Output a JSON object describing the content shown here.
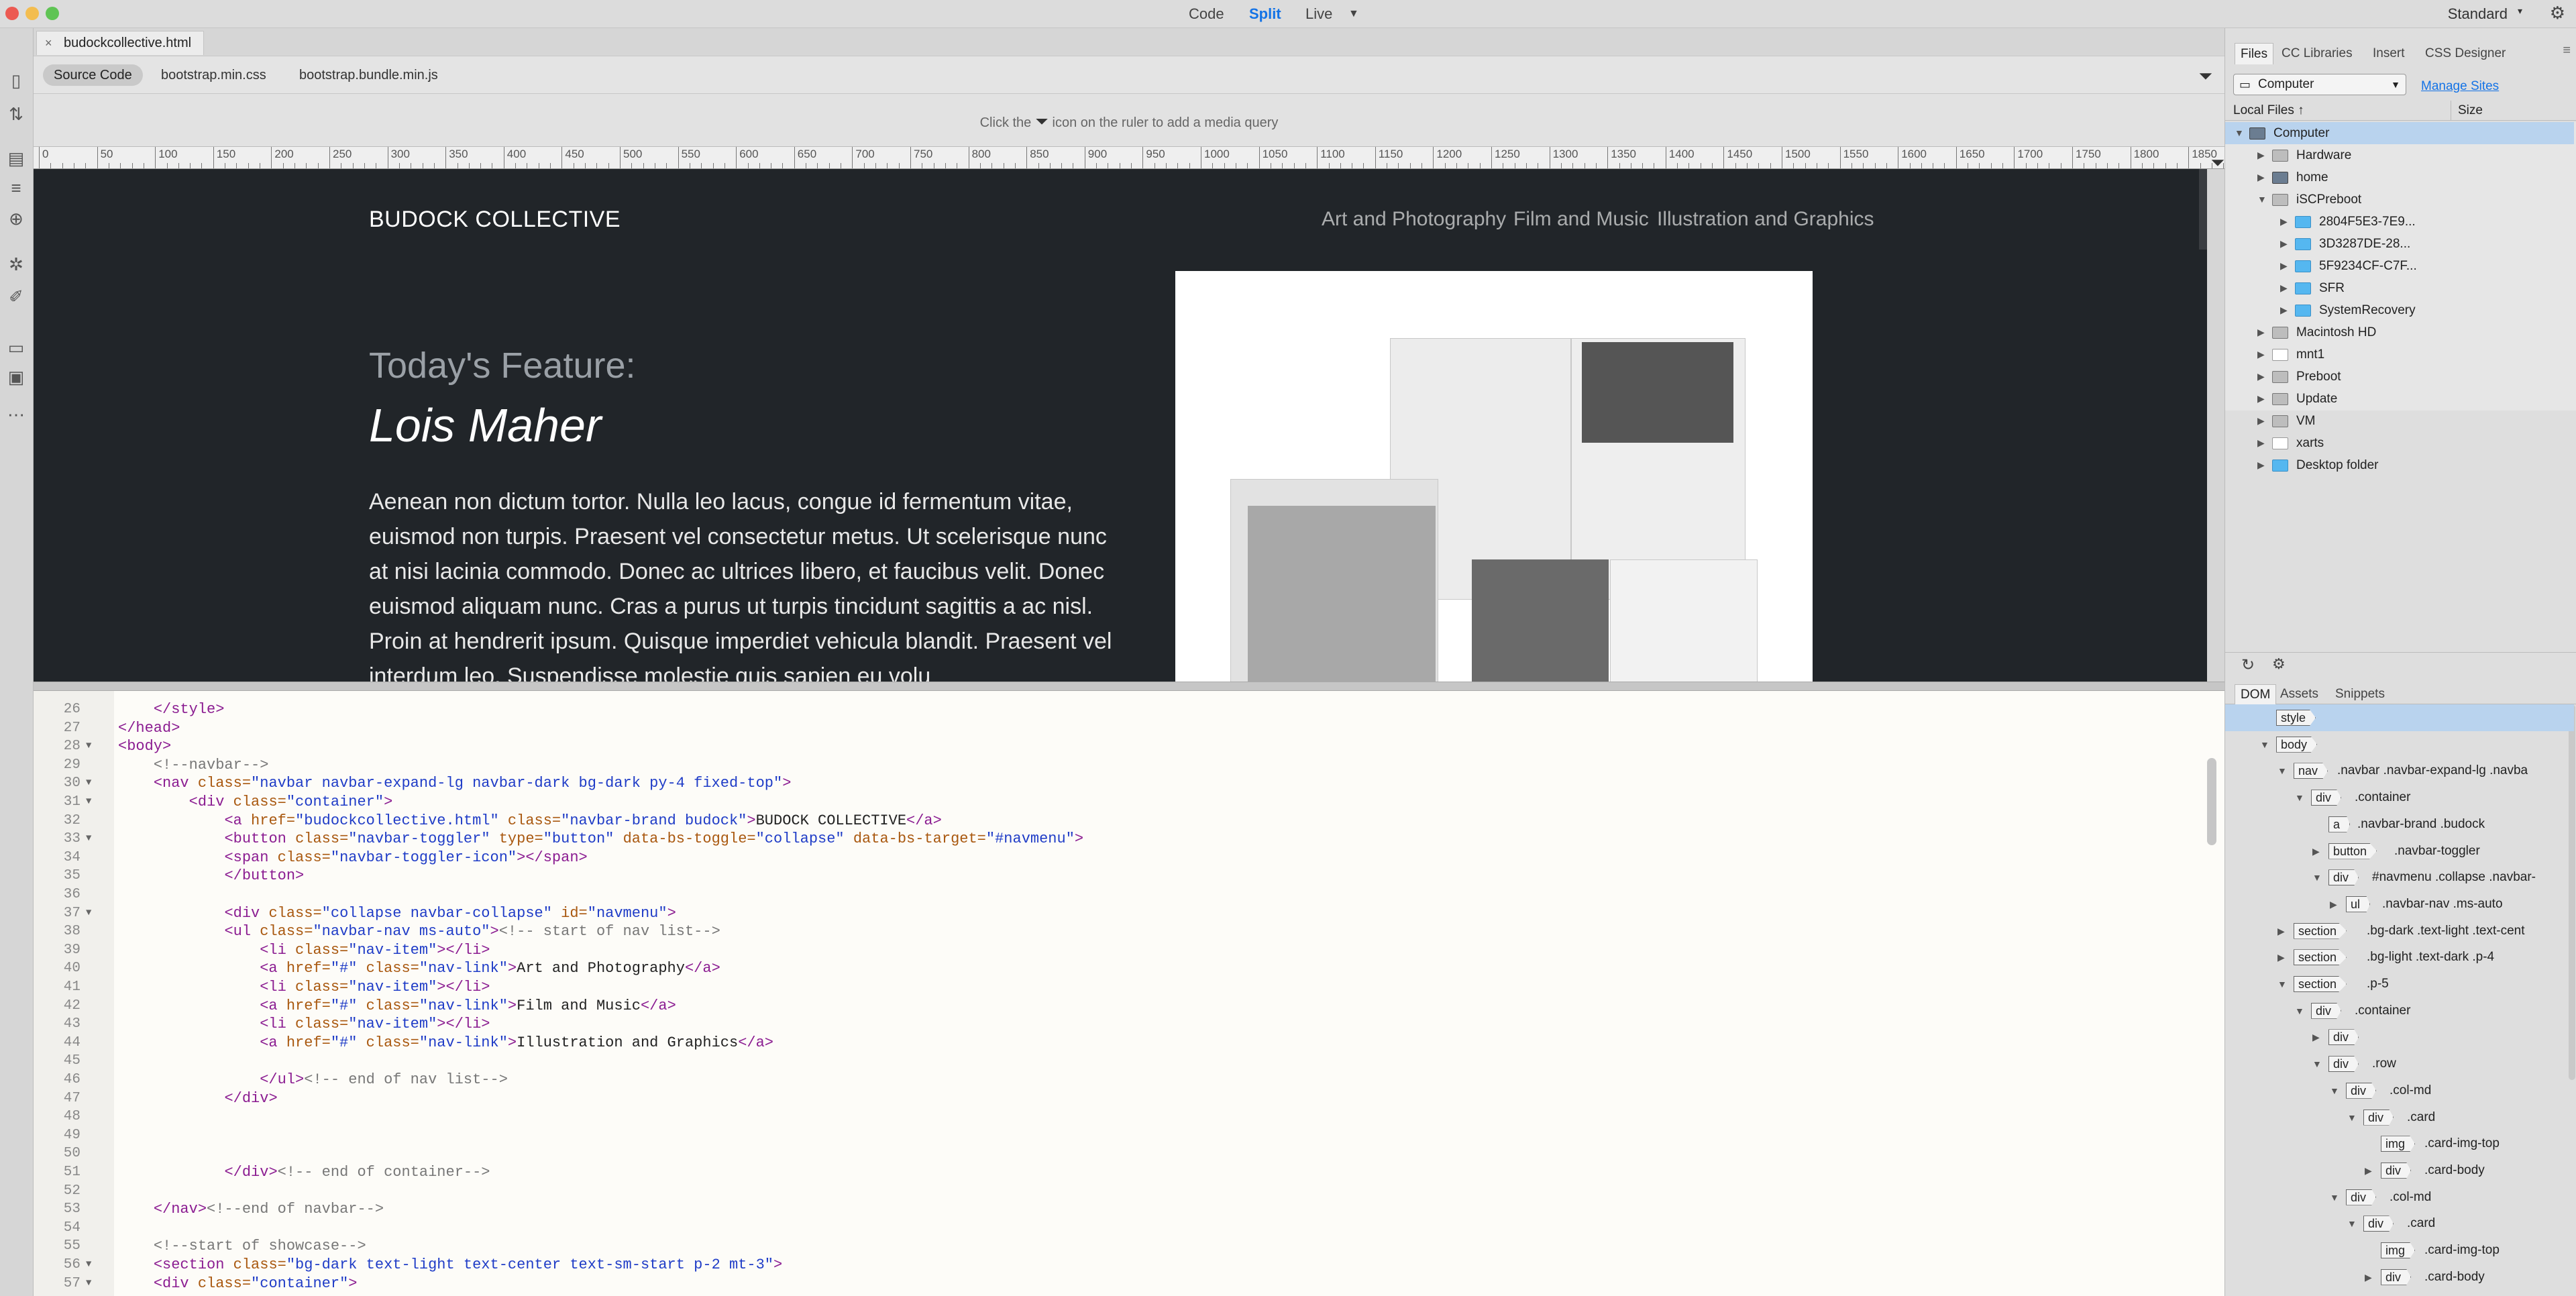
{
  "window": {
    "view_buttons": [
      "Code",
      "Split",
      "Live"
    ],
    "workspace": "Standard"
  },
  "doc_tab": {
    "name": "budockcollective.html"
  },
  "related_files": [
    "Source Code",
    "bootstrap.min.css",
    "bootstrap.bundle.min.js"
  ],
  "media_query": {
    "before": "Click the",
    "after": "icon on the ruler to add a media query"
  },
  "ruler": [
    "0",
    "50",
    "100",
    "150",
    "200",
    "250",
    "300",
    "350",
    "400",
    "450",
    "500",
    "550",
    "600",
    "650",
    "700",
    "750",
    "800",
    "850",
    "900",
    "950",
    "1000",
    "1050",
    "1100",
    "1150",
    "1200",
    "1250",
    "1300",
    "1350",
    "1400",
    "1450",
    "1500",
    "1550",
    "1600",
    "1650",
    "1700",
    "1750",
    "1800",
    "1850"
  ],
  "preview": {
    "brand": "BUDOCK COLLECTIVE",
    "nav": [
      "Art and Photography",
      "Film and Music",
      "Illustration and Graphics"
    ],
    "heading": "Today's Feature:",
    "name": "Lois Maher",
    "body": "Aenean non dictum tortor. Nulla leo lacus, congue id fermentum vitae, euismod non turpis. Praesent vel consectetur metus. Ut scelerisque nunc at nisi lacinia commodo. Donec ac ultrices libero, et faucibus velit. Donec euismod aliquam nunc. Cras a purus ut turpis tincidunt sagittis a ac nisl. Proin at hendrerit ipsum. Quisque imperdiet vehicula blandit. Praesent vel interdum leo. Suspendisse molestie quis sapien eu volu"
  },
  "code": {
    "lines": [
      {
        "n": "26",
        "fold": "",
        "html": "    <span class=\"tg\">&lt;/style&gt;</span>"
      },
      {
        "n": "27",
        "fold": "",
        "html": "<span class=\"tg\">&lt;/head&gt;</span>"
      },
      {
        "n": "28",
        "fold": "▼",
        "html": "<span class=\"tg\">&lt;body&gt;</span>"
      },
      {
        "n": "29",
        "fold": "",
        "html": "    <span class=\"cm\">&lt;!--navbar--&gt;</span>"
      },
      {
        "n": "30",
        "fold": "▼",
        "html": "    <span class=\"tg\">&lt;nav</span> <span class=\"at\">class=</span><span class=\"vl\">\"navbar navbar-expand-lg navbar-dark bg-dark py-4 fixed-top\"</span><span class=\"tg\">&gt;</span>"
      },
      {
        "n": "31",
        "fold": "▼",
        "html": "        <span class=\"tg\">&lt;div</span> <span class=\"at\">class=</span><span class=\"vl\">\"container\"</span><span class=\"tg\">&gt;</span>"
      },
      {
        "n": "32",
        "fold": "",
        "html": "            <span class=\"tg\">&lt;a</span> <span class=\"at\">href=</span><span class=\"vl\">\"budockcollective.html\"</span> <span class=\"at\">class=</span><span class=\"vl\">\"navbar-brand budock\"</span><span class=\"tg\">&gt;</span><span class=\"tx\">BUDOCK COLLECTIVE</span><span class=\"tg\">&lt;/a&gt;</span>"
      },
      {
        "n": "33",
        "fold": "▼",
        "html": "            <span class=\"tg\">&lt;button</span> <span class=\"at\">class=</span><span class=\"vl\">\"navbar-toggler\"</span> <span class=\"at\">type=</span><span class=\"vl\">\"button\"</span> <span class=\"at\">data-bs-toggle=</span><span class=\"vl\">\"collapse\"</span> <span class=\"at\">data-bs-target=</span><span class=\"vl\">\"#navmenu\"</span><span class=\"tg\">&gt;</span>"
      },
      {
        "n": "34",
        "fold": "",
        "html": "            <span class=\"tg\">&lt;span</span> <span class=\"at\">class=</span><span class=\"vl\">\"navbar-toggler-icon\"</span><span class=\"tg\">&gt;&lt;/span&gt;</span>"
      },
      {
        "n": "35",
        "fold": "",
        "html": "            <span class=\"tg\">&lt;/button&gt;</span>"
      },
      {
        "n": "36",
        "fold": "",
        "html": ""
      },
      {
        "n": "37",
        "fold": "▼",
        "html": "            <span class=\"tg\">&lt;div</span> <span class=\"at\">class=</span><span class=\"vl\">\"collapse navbar-collapse\"</span> <span class=\"at\">id=</span><span class=\"vl\">\"navmenu\"</span><span class=\"tg\">&gt;</span>"
      },
      {
        "n": "38",
        "fold": "",
        "html": "            <span class=\"tg\">&lt;ul</span> <span class=\"at\">class=</span><span class=\"vl\">\"navbar-nav ms-auto\"</span><span class=\"tg\">&gt;</span><span class=\"cm\">&lt;!-- start of nav list--&gt;</span>"
      },
      {
        "n": "39",
        "fold": "",
        "html": "                <span class=\"tg\">&lt;li</span> <span class=\"at\">class=</span><span class=\"vl\">\"nav-item\"</span><span class=\"tg\">&gt;&lt;/li&gt;</span>"
      },
      {
        "n": "40",
        "fold": "",
        "html": "                <span class=\"tg\">&lt;a</span> <span class=\"at\">href=</span><span class=\"vl\">\"#\"</span> <span class=\"at\">class=</span><span class=\"vl\">\"nav-link\"</span><span class=\"tg\">&gt;</span><span class=\"tx\">Art and Photography</span><span class=\"tg\">&lt;/a&gt;</span>"
      },
      {
        "n": "41",
        "fold": "",
        "html": "                <span class=\"tg\">&lt;li</span> <span class=\"at\">class=</span><span class=\"vl\">\"nav-item\"</span><span class=\"tg\">&gt;&lt;/li&gt;</span>"
      },
      {
        "n": "42",
        "fold": "",
        "html": "                <span class=\"tg\">&lt;a</span> <span class=\"at\">href=</span><span class=\"vl\">\"#\"</span> <span class=\"at\">class=</span><span class=\"vl\">\"nav-link\"</span><span class=\"tg\">&gt;</span><span class=\"tx\">Film and Music</span><span class=\"tg\">&lt;/a&gt;</span>"
      },
      {
        "n": "43",
        "fold": "",
        "html": "                <span class=\"tg\">&lt;li</span> <span class=\"at\">class=</span><span class=\"vl\">\"nav-item\"</span><span class=\"tg\">&gt;&lt;/li&gt;</span>"
      },
      {
        "n": "44",
        "fold": "",
        "html": "                <span class=\"tg\">&lt;a</span> <span class=\"at\">href=</span><span class=\"vl\">\"#\"</span> <span class=\"at\">class=</span><span class=\"vl\">\"nav-link\"</span><span class=\"tg\">&gt;</span><span class=\"tx\">Illustration and Graphics</span><span class=\"tg\">&lt;/a&gt;</span>"
      },
      {
        "n": "45",
        "fold": "",
        "html": ""
      },
      {
        "n": "46",
        "fold": "",
        "html": "                <span class=\"tg\">&lt;/ul&gt;</span><span class=\"cm\">&lt;!-- end of nav list--&gt;</span>"
      },
      {
        "n": "47",
        "fold": "",
        "html": "            <span class=\"tg\">&lt;/div&gt;</span>"
      },
      {
        "n": "48",
        "fold": "",
        "html": ""
      },
      {
        "n": "49",
        "fold": "",
        "html": ""
      },
      {
        "n": "50",
        "fold": "",
        "html": ""
      },
      {
        "n": "51",
        "fold": "",
        "html": "            <span class=\"tg\">&lt;/div&gt;</span><span class=\"cm\">&lt;!-- end of container--&gt;</span>"
      },
      {
        "n": "52",
        "fold": "",
        "html": ""
      },
      {
        "n": "53",
        "fold": "",
        "html": "    <span class=\"tg\">&lt;/nav&gt;</span><span class=\"cm\">&lt;!--end of navbar--&gt;</span>"
      },
      {
        "n": "54",
        "fold": "",
        "html": ""
      },
      {
        "n": "55",
        "fold": "",
        "html": "    <span class=\"cm\">&lt;!--start of showcase--&gt;</span>"
      },
      {
        "n": "56",
        "fold": "▼",
        "html": "    <span class=\"tg\">&lt;section</span> <span class=\"at\">class=</span><span class=\"vl\">\"bg-dark text-light text-center text-sm-start p-2 mt-3\"</span><span class=\"tg\">&gt;</span>"
      },
      {
        "n": "57",
        "fold": "▼",
        "html": "    <span class=\"tg\">&lt;div</span> <span class=\"at\">class=</span><span class=\"vl\">\"container\"</span><span class=\"tg\">&gt;</span>"
      }
    ]
  },
  "panel": {
    "tabs": [
      "Files",
      "CC Libraries",
      "Insert",
      "CSS Designer"
    ],
    "site": "Computer",
    "manage_sites": "Manage Sites",
    "local_files": "Local Files ↑",
    "size": "Size",
    "tree": [
      {
        "label": "Computer",
        "depth": 0,
        "arrow": "▼",
        "icon": "comp"
      },
      {
        "label": "Hardware",
        "depth": 1,
        "arrow": "▶",
        "icon": "drive"
      },
      {
        "label": "home",
        "depth": 1,
        "arrow": "▶",
        "icon": "comp"
      },
      {
        "label": "iSCPreboot",
        "depth": 1,
        "arrow": "▼",
        "icon": "drive"
      },
      {
        "label": "2804F5E3-7E9...",
        "depth": 2,
        "arrow": "▶",
        "icon": "folder"
      },
      {
        "label": "3D3287DE-28...",
        "depth": 2,
        "arrow": "▶",
        "icon": "folder"
      },
      {
        "label": "5F9234CF-C7F...",
        "depth": 2,
        "arrow": "▶",
        "icon": "folder"
      },
      {
        "label": "SFR",
        "depth": 2,
        "arrow": "▶",
        "icon": "folder"
      },
      {
        "label": "SystemRecovery",
        "depth": 2,
        "arrow": "▶",
        "icon": "folder"
      },
      {
        "label": "Macintosh HD",
        "depth": 1,
        "arrow": "▶",
        "icon": "drive"
      },
      {
        "label": "mnt1",
        "depth": 1,
        "arrow": "▶",
        "icon": "doc"
      },
      {
        "label": "Preboot",
        "depth": 1,
        "arrow": "▶",
        "icon": "drive"
      },
      {
        "label": "Update",
        "depth": 1,
        "arrow": "▶",
        "icon": "drive"
      },
      {
        "label": "VM",
        "depth": 1,
        "arrow": "▶",
        "icon": "drive"
      },
      {
        "label": "xarts",
        "depth": 1,
        "arrow": "▶",
        "icon": "doc"
      },
      {
        "label": "Desktop folder",
        "depth": 1,
        "arrow": "▶",
        "icon": "folder"
      }
    ],
    "dom_tabs": [
      "DOM",
      "Assets",
      "Snippets"
    ],
    "dom": [
      {
        "tag": "style",
        "sel": "",
        "depth": 0,
        "arrow": ""
      },
      {
        "tag": "body",
        "sel": "",
        "depth": 0,
        "arrow": "▼"
      },
      {
        "tag": "nav",
        "sel": ".navbar .navbar-expand-lg .navba",
        "depth": 1,
        "arrow": "▼"
      },
      {
        "tag": "div",
        "sel": ".container",
        "depth": 2,
        "arrow": "▼"
      },
      {
        "tag": "a",
        "sel": ".navbar-brand .budock",
        "depth": 3,
        "arrow": ""
      },
      {
        "tag": "button",
        "sel": ".navbar-toggler",
        "depth": 3,
        "arrow": "▶"
      },
      {
        "tag": "div",
        "sel": "#navmenu .collapse .navbar-",
        "depth": 3,
        "arrow": "▼"
      },
      {
        "tag": "ul",
        "sel": ".navbar-nav .ms-auto",
        "depth": 4,
        "arrow": "▶"
      },
      {
        "tag": "section",
        "sel": ".bg-dark .text-light .text-cent",
        "depth": 1,
        "arrow": "▶"
      },
      {
        "tag": "section",
        "sel": ".bg-light .text-dark .p-4",
        "depth": 1,
        "arrow": "▶"
      },
      {
        "tag": "section",
        "sel": ".p-5",
        "depth": 1,
        "arrow": "▼"
      },
      {
        "tag": "div",
        "sel": ".container",
        "depth": 2,
        "arrow": "▼"
      },
      {
        "tag": "div",
        "sel": "",
        "depth": 3,
        "arrow": "▶"
      },
      {
        "tag": "div",
        "sel": ".row",
        "depth": 3,
        "arrow": "▼"
      },
      {
        "tag": "div",
        "sel": ".col-md",
        "depth": 4,
        "arrow": "▼"
      },
      {
        "tag": "div",
        "sel": ".card",
        "depth": 5,
        "arrow": "▼"
      },
      {
        "tag": "img",
        "sel": ".card-img-top",
        "depth": 6,
        "arrow": ""
      },
      {
        "tag": "div",
        "sel": ".card-body",
        "depth": 6,
        "arrow": "▶"
      },
      {
        "tag": "div",
        "sel": ".col-md",
        "depth": 4,
        "arrow": "▼"
      },
      {
        "tag": "div",
        "sel": ".card",
        "depth": 5,
        "arrow": "▼"
      },
      {
        "tag": "img",
        "sel": ".card-img-top",
        "depth": 6,
        "arrow": ""
      },
      {
        "tag": "div",
        "sel": ".card-body",
        "depth": 6,
        "arrow": "▶"
      }
    ]
  }
}
